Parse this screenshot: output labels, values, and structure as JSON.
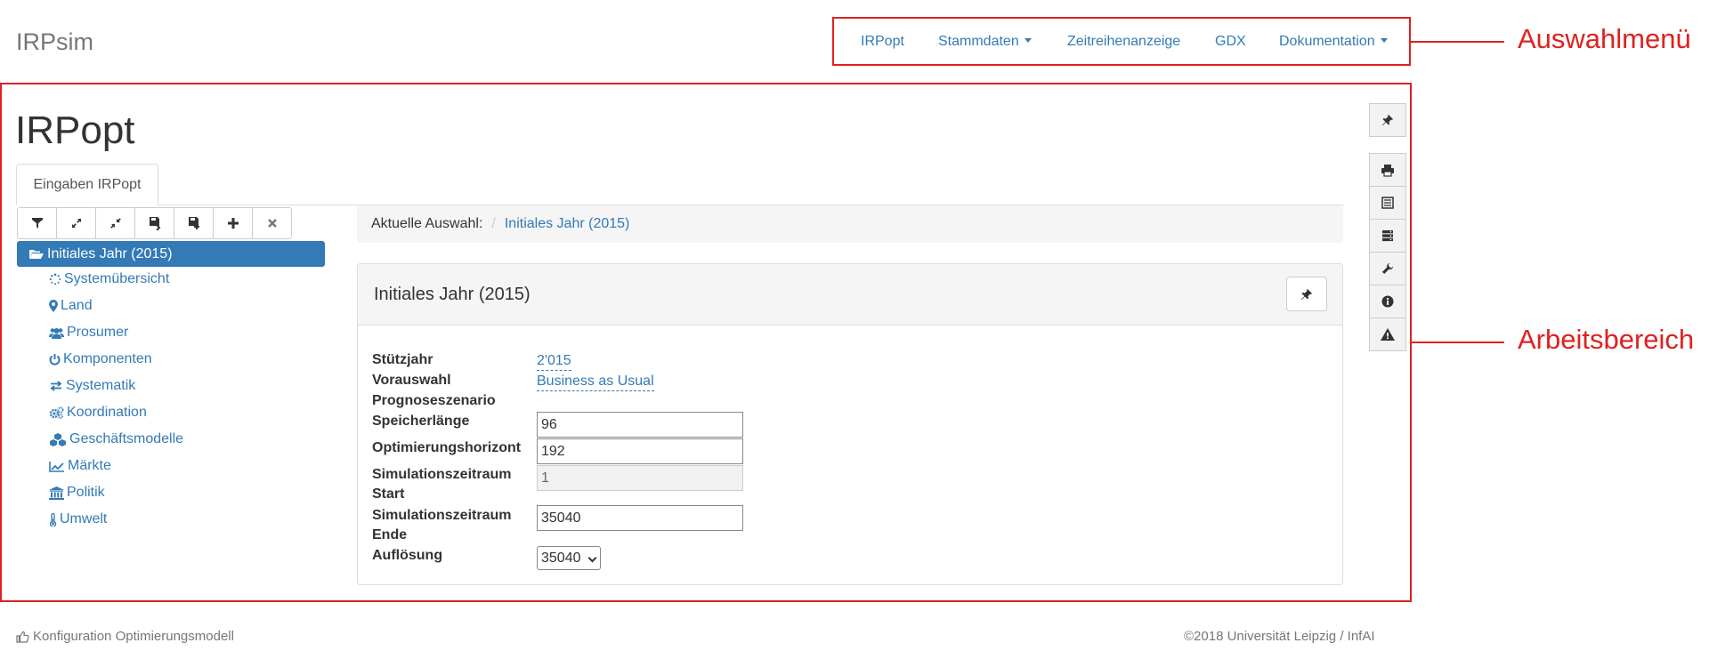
{
  "brand": "IRPsim",
  "nav": {
    "items": [
      {
        "label": "IRPopt"
      },
      {
        "label": "Stammdaten"
      },
      {
        "label": "Zeitreihenanzeige"
      },
      {
        "label": "GDX"
      },
      {
        "label": "Dokumentation"
      }
    ]
  },
  "callouts": {
    "menu": "Auswahlmenü",
    "work": "Arbeitsbereich"
  },
  "page_title": "IRPopt",
  "tab": {
    "label": "Eingaben IRPopt"
  },
  "toolbar": {
    "icons": [
      "filter-icon",
      "expand-icon",
      "collapse-icon",
      "save-icon",
      "save-as-icon",
      "plus-icon",
      "close-icon"
    ]
  },
  "tree": {
    "selected": "Initiales Jahr (2015)",
    "items": [
      {
        "label": "Systemübersicht",
        "icon": "spinner-icon"
      },
      {
        "label": "Land",
        "icon": "map-marker-icon"
      },
      {
        "label": "Prosumer",
        "icon": "users-icon"
      },
      {
        "label": "Komponenten",
        "icon": "power-icon"
      },
      {
        "label": "Systematik",
        "icon": "exchange-icon"
      },
      {
        "label": "Koordination",
        "icon": "cogs-icon"
      },
      {
        "label": "Geschäftsmodelle",
        "icon": "cubes-icon"
      },
      {
        "label": "Märkte",
        "icon": "line-chart-icon"
      },
      {
        "label": "Politik",
        "icon": "bank-icon"
      },
      {
        "label": "Umwelt",
        "icon": "thermometer-icon"
      }
    ]
  },
  "breadcrumb": {
    "label": "Aktuelle Auswahl:",
    "separator": "/",
    "current": "Initiales Jahr (2015)"
  },
  "panel": {
    "title": "Initiales Jahr (2015)",
    "fields": {
      "stuetzjahr": {
        "label": "Stützjahr",
        "value": "2'015"
      },
      "vorauswahl": {
        "label_line1": "Vorauswahl",
        "label_line2": "Prognoseszenario",
        "value": "Business as Usual"
      },
      "speicherlaenge": {
        "label": "Speicherlänge",
        "value": "96"
      },
      "optimierungshorizont": {
        "label": "Optimierungshorizont",
        "value": "192"
      },
      "sim_start": {
        "label_line1": "Simulationszeitraum",
        "label_line2": "Start",
        "value": "1"
      },
      "sim_ende": {
        "label_line1": "Simulationszeitraum",
        "label_line2": "Ende",
        "value": "35040"
      },
      "aufloesung": {
        "label": "Auflösung",
        "value": "35040"
      }
    }
  },
  "side_toolbar": {
    "icons": [
      "pin-icon",
      "print-icon",
      "list-icon",
      "server-icon",
      "wrench-icon",
      "info-icon",
      "warning-icon"
    ]
  },
  "footer": {
    "left": "Konfiguration Optimierungsmodell",
    "right": "©2018 Universität Leipzig / InfAI"
  },
  "colors": {
    "accent": "#337ab7",
    "annotation": "#e02020",
    "muted": "#777777"
  }
}
